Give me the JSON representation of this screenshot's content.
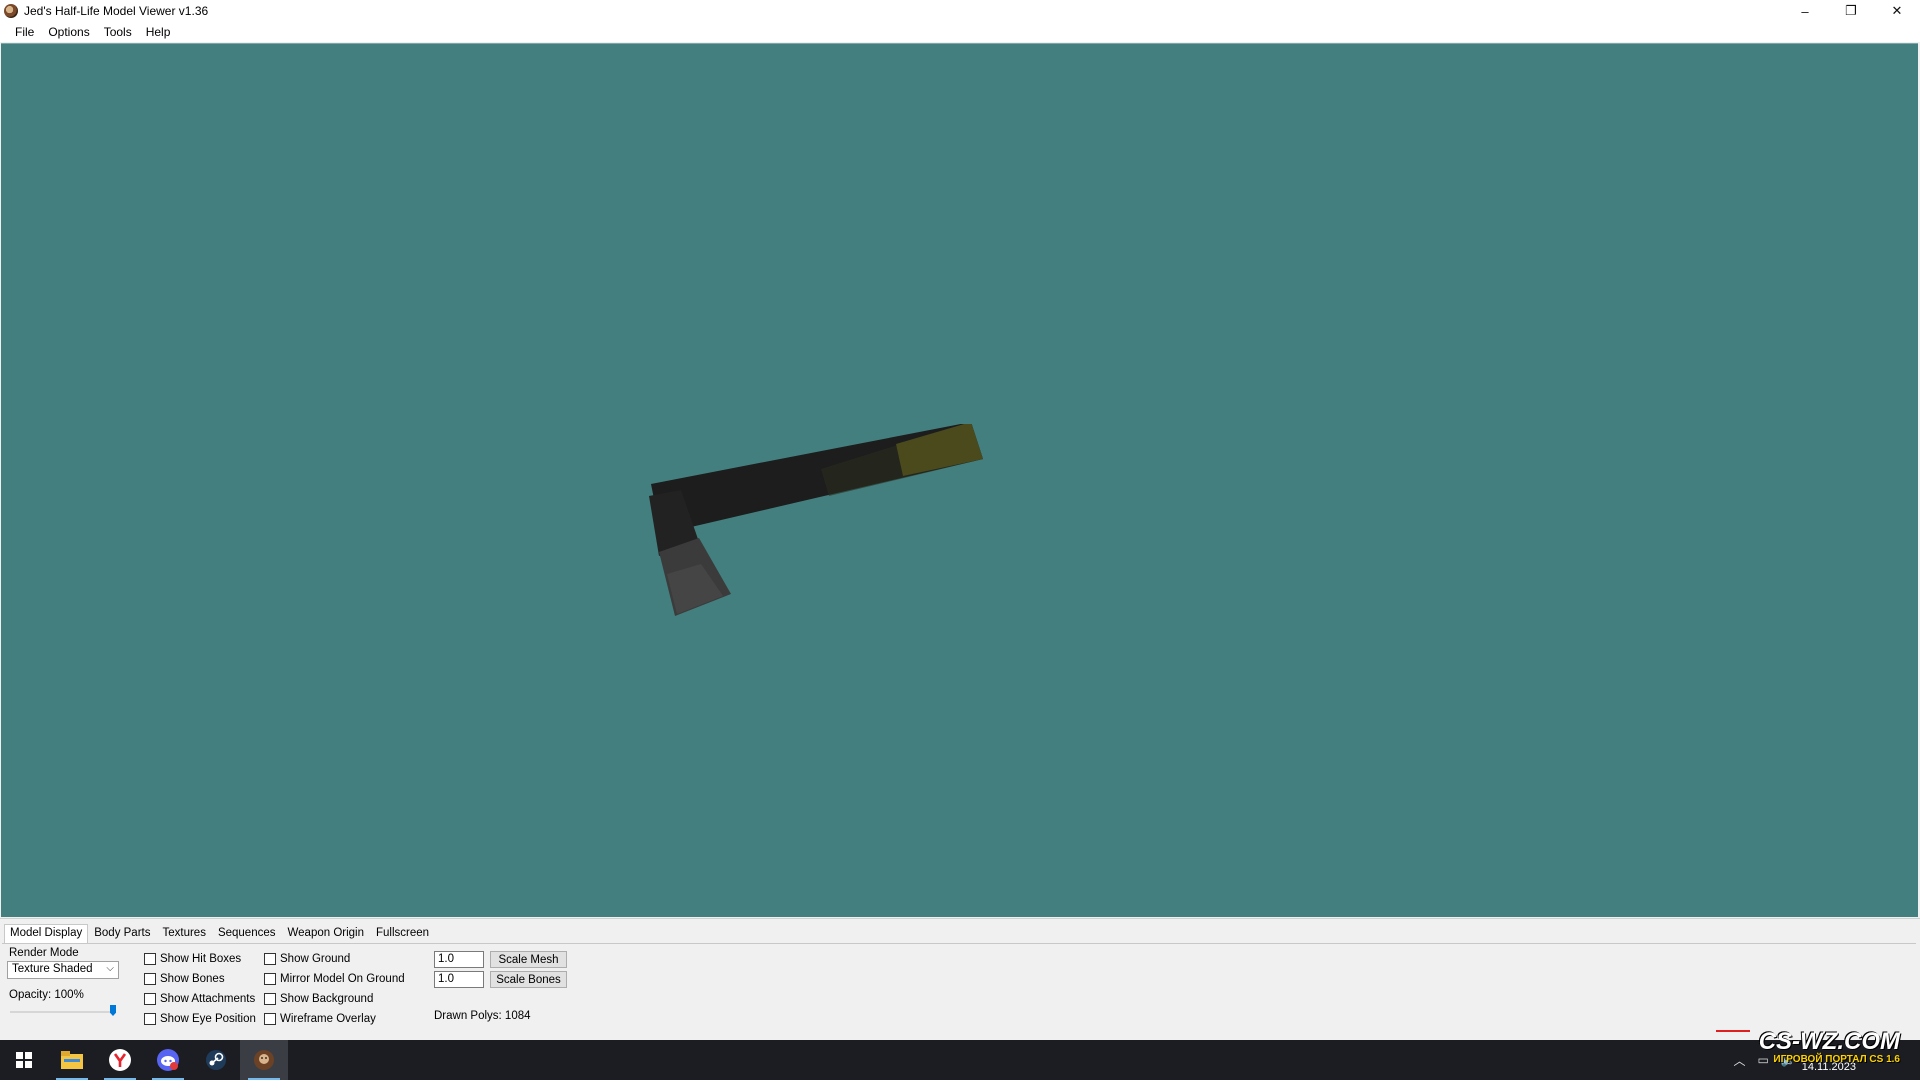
{
  "window": {
    "title": "Jed's Half-Life Model Viewer v1.36",
    "controls": {
      "minimize": "–",
      "restore": "❐",
      "close": "✕"
    }
  },
  "menu": [
    "File",
    "Options",
    "Tools",
    "Help"
  ],
  "viewport": {
    "background": "#427f7e"
  },
  "tabs": [
    "Model Display",
    "Body Parts",
    "Textures",
    "Sequences",
    "Weapon Origin",
    "Fullscreen"
  ],
  "model_display": {
    "render_mode_label": "Render Mode",
    "render_mode_value": "Texture Shaded",
    "opacity_label": "Opacity: 100%",
    "opacity_value": 1.0,
    "checkboxes_col1": [
      "Show Hit Boxes",
      "Show Bones",
      "Show Attachments",
      "Show Eye Position"
    ],
    "checkboxes_col2": [
      "Show Ground",
      "Mirror Model On Ground",
      "Show Background",
      "Wireframe Overlay"
    ],
    "scale_mesh_value": "1.0",
    "scale_mesh_button": "Scale Mesh",
    "scale_bones_value": "1.0",
    "scale_bones_button": "Scale Bones",
    "drawn_polys": "Drawn Polys: 1084"
  },
  "taskbar": {
    "icons": [
      "windows-start-icon",
      "file-explorer-icon",
      "yandex-browser-icon",
      "discord-icon",
      "steam-icon",
      "model-viewer-icon"
    ],
    "tray": {
      "date": "14.11.2023"
    }
  },
  "watermark": {
    "main": "CS-WZ.COM",
    "sub": "ИГРОВОЙ ПОРТАЛ CS 1.6"
  }
}
